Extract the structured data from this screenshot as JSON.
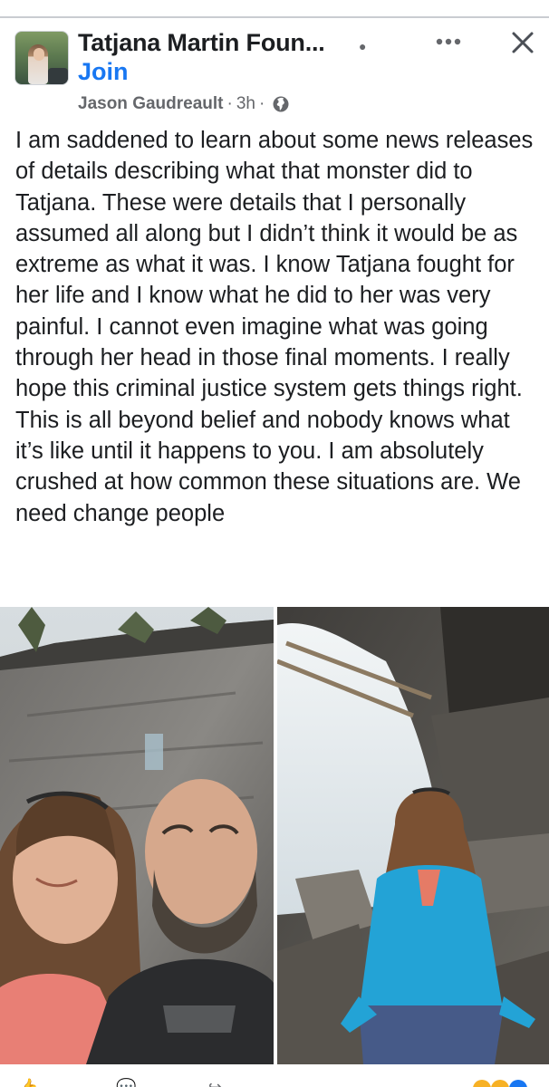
{
  "post": {
    "group_name": "Tatjana Martin Foun...",
    "join_label": "Join",
    "author": "Jason Gaudreault",
    "time": "3h",
    "privacy_icon": "globe-icon",
    "text": "I am saddened to learn about some news releases of details describing what that monster did to Tatjana. These were details that I personally assumed all along but I didn’t think it would be as extreme as what it was. I know Tatjana fought for her life and I know what he did to her was very painful. I cannot even imagine what was going through her head in those final moments. I really hope this criminal justice system gets things right. This is all beyond belief and nobody knows what it’s like until it happens to you. I am absolutely crushed at how common these situations are. We need change people"
  },
  "photos": [
    {
      "subject": "selfie of a woman and a bald bearded man in front of a granite cliff"
    },
    {
      "subject": "woman in a blue jacket sitting by a waterfall among rocks"
    }
  ],
  "icons": {
    "more": "more-horizontal-icon",
    "close": "close-icon"
  },
  "colors": {
    "join": "#1877f2",
    "meta": "#65676b",
    "text": "#1c1e21"
  }
}
